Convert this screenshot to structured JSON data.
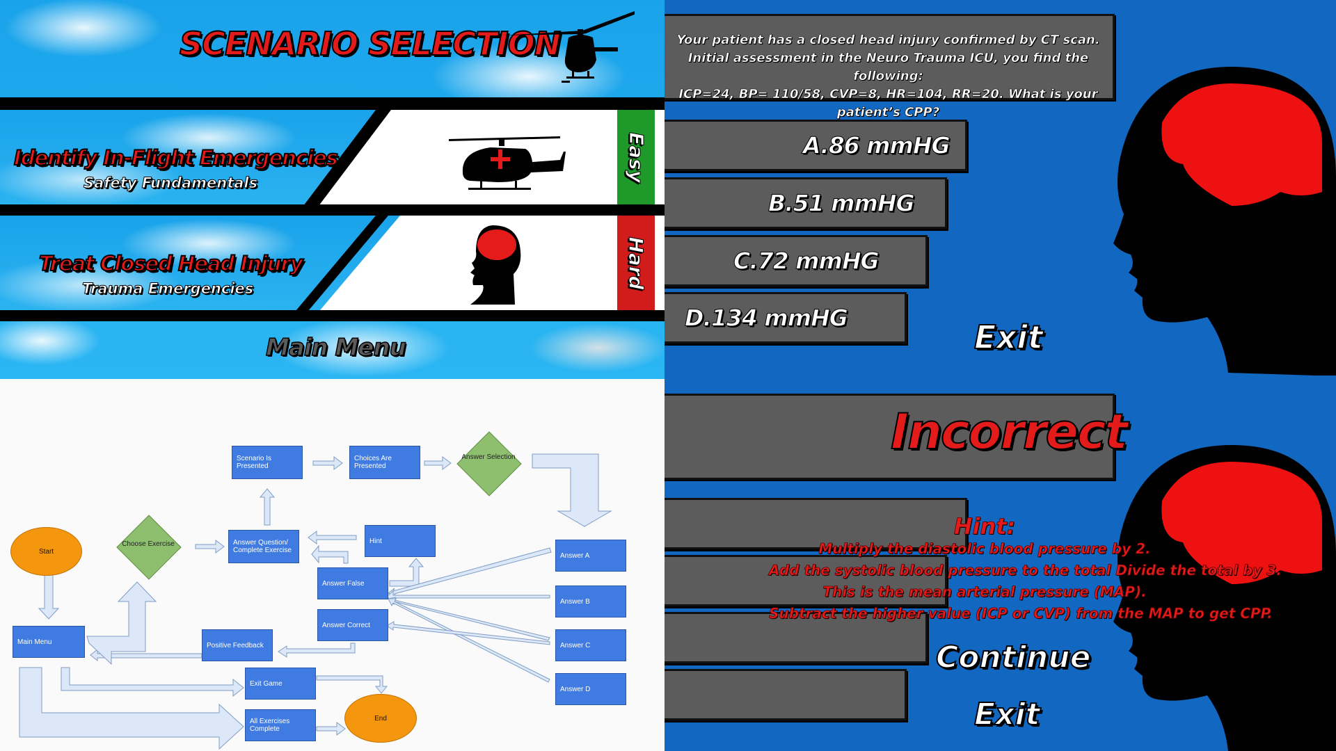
{
  "scenario_selection": {
    "title": "SCENARIO SELECTION",
    "options": [
      {
        "title": "Identify In-Flight Emergencies",
        "subtitle": "Safety Fundamentals",
        "difficulty": "Easy",
        "difficulty_color": "#1f9a2a",
        "icon": "medical-helicopter-icon"
      },
      {
        "title": "Treat Closed Head Injury",
        "subtitle": "Trauma Emergencies",
        "difficulty": "Hard",
        "difficulty_color": "#d21c1c",
        "icon": "head-brain-icon"
      }
    ],
    "main_menu": "Main Menu"
  },
  "quiz": {
    "question_lines": [
      "Your patient has a closed head injury confirmed by CT scan.",
      "Initial assessment in the Neuro Trauma ICU, you find the following:",
      "ICP=24, BP= 110/58, CVP=8, HR=104, RR=20. What is your patient’s CPP?"
    ],
    "answers": [
      "A.86 mmHG",
      "B.51 mmHG",
      "C.72 mmHG",
      "D.134 mmHG"
    ],
    "exit": "Exit",
    "result": "Incorrect",
    "hint_title": "Hint:",
    "hint_lines": [
      "Multiply the diastolic blood pressure by 2.",
      "Add the systolic blood pressure to the total Divide the total by 3.",
      "This is the mean arterial pressure (MAP).",
      "Subtract the higher value (ICP or CVP) from the MAP to get CPP."
    ],
    "continue": "Continue",
    "exit2": "Exit",
    "colors": {
      "background": "#1267c0",
      "brain": "#ee1111",
      "button": "#5c5c5c"
    }
  },
  "flowchart": {
    "nodes": {
      "start": "Start",
      "choose_exercise": "Choose Exercise",
      "answer_question": "Answer Question/ Complete Exercise",
      "scenario_presented": "Scenario Is Presented",
      "choices_presented": "Choices Are Presented",
      "answer_selection": "Answer Selection",
      "hint": "Hint",
      "answer_false": "Answer False",
      "answer_correct": "Answer Correct",
      "answer_a": "Answer A",
      "answer_b": "Answer B",
      "answer_c": "Answer C",
      "answer_d": "Answer D",
      "main_menu": "Main Menu",
      "positive_feedback": "Positive Feedback",
      "exit_game": "Exit Game",
      "all_complete": "All Exercises Complete",
      "end": "End"
    }
  }
}
